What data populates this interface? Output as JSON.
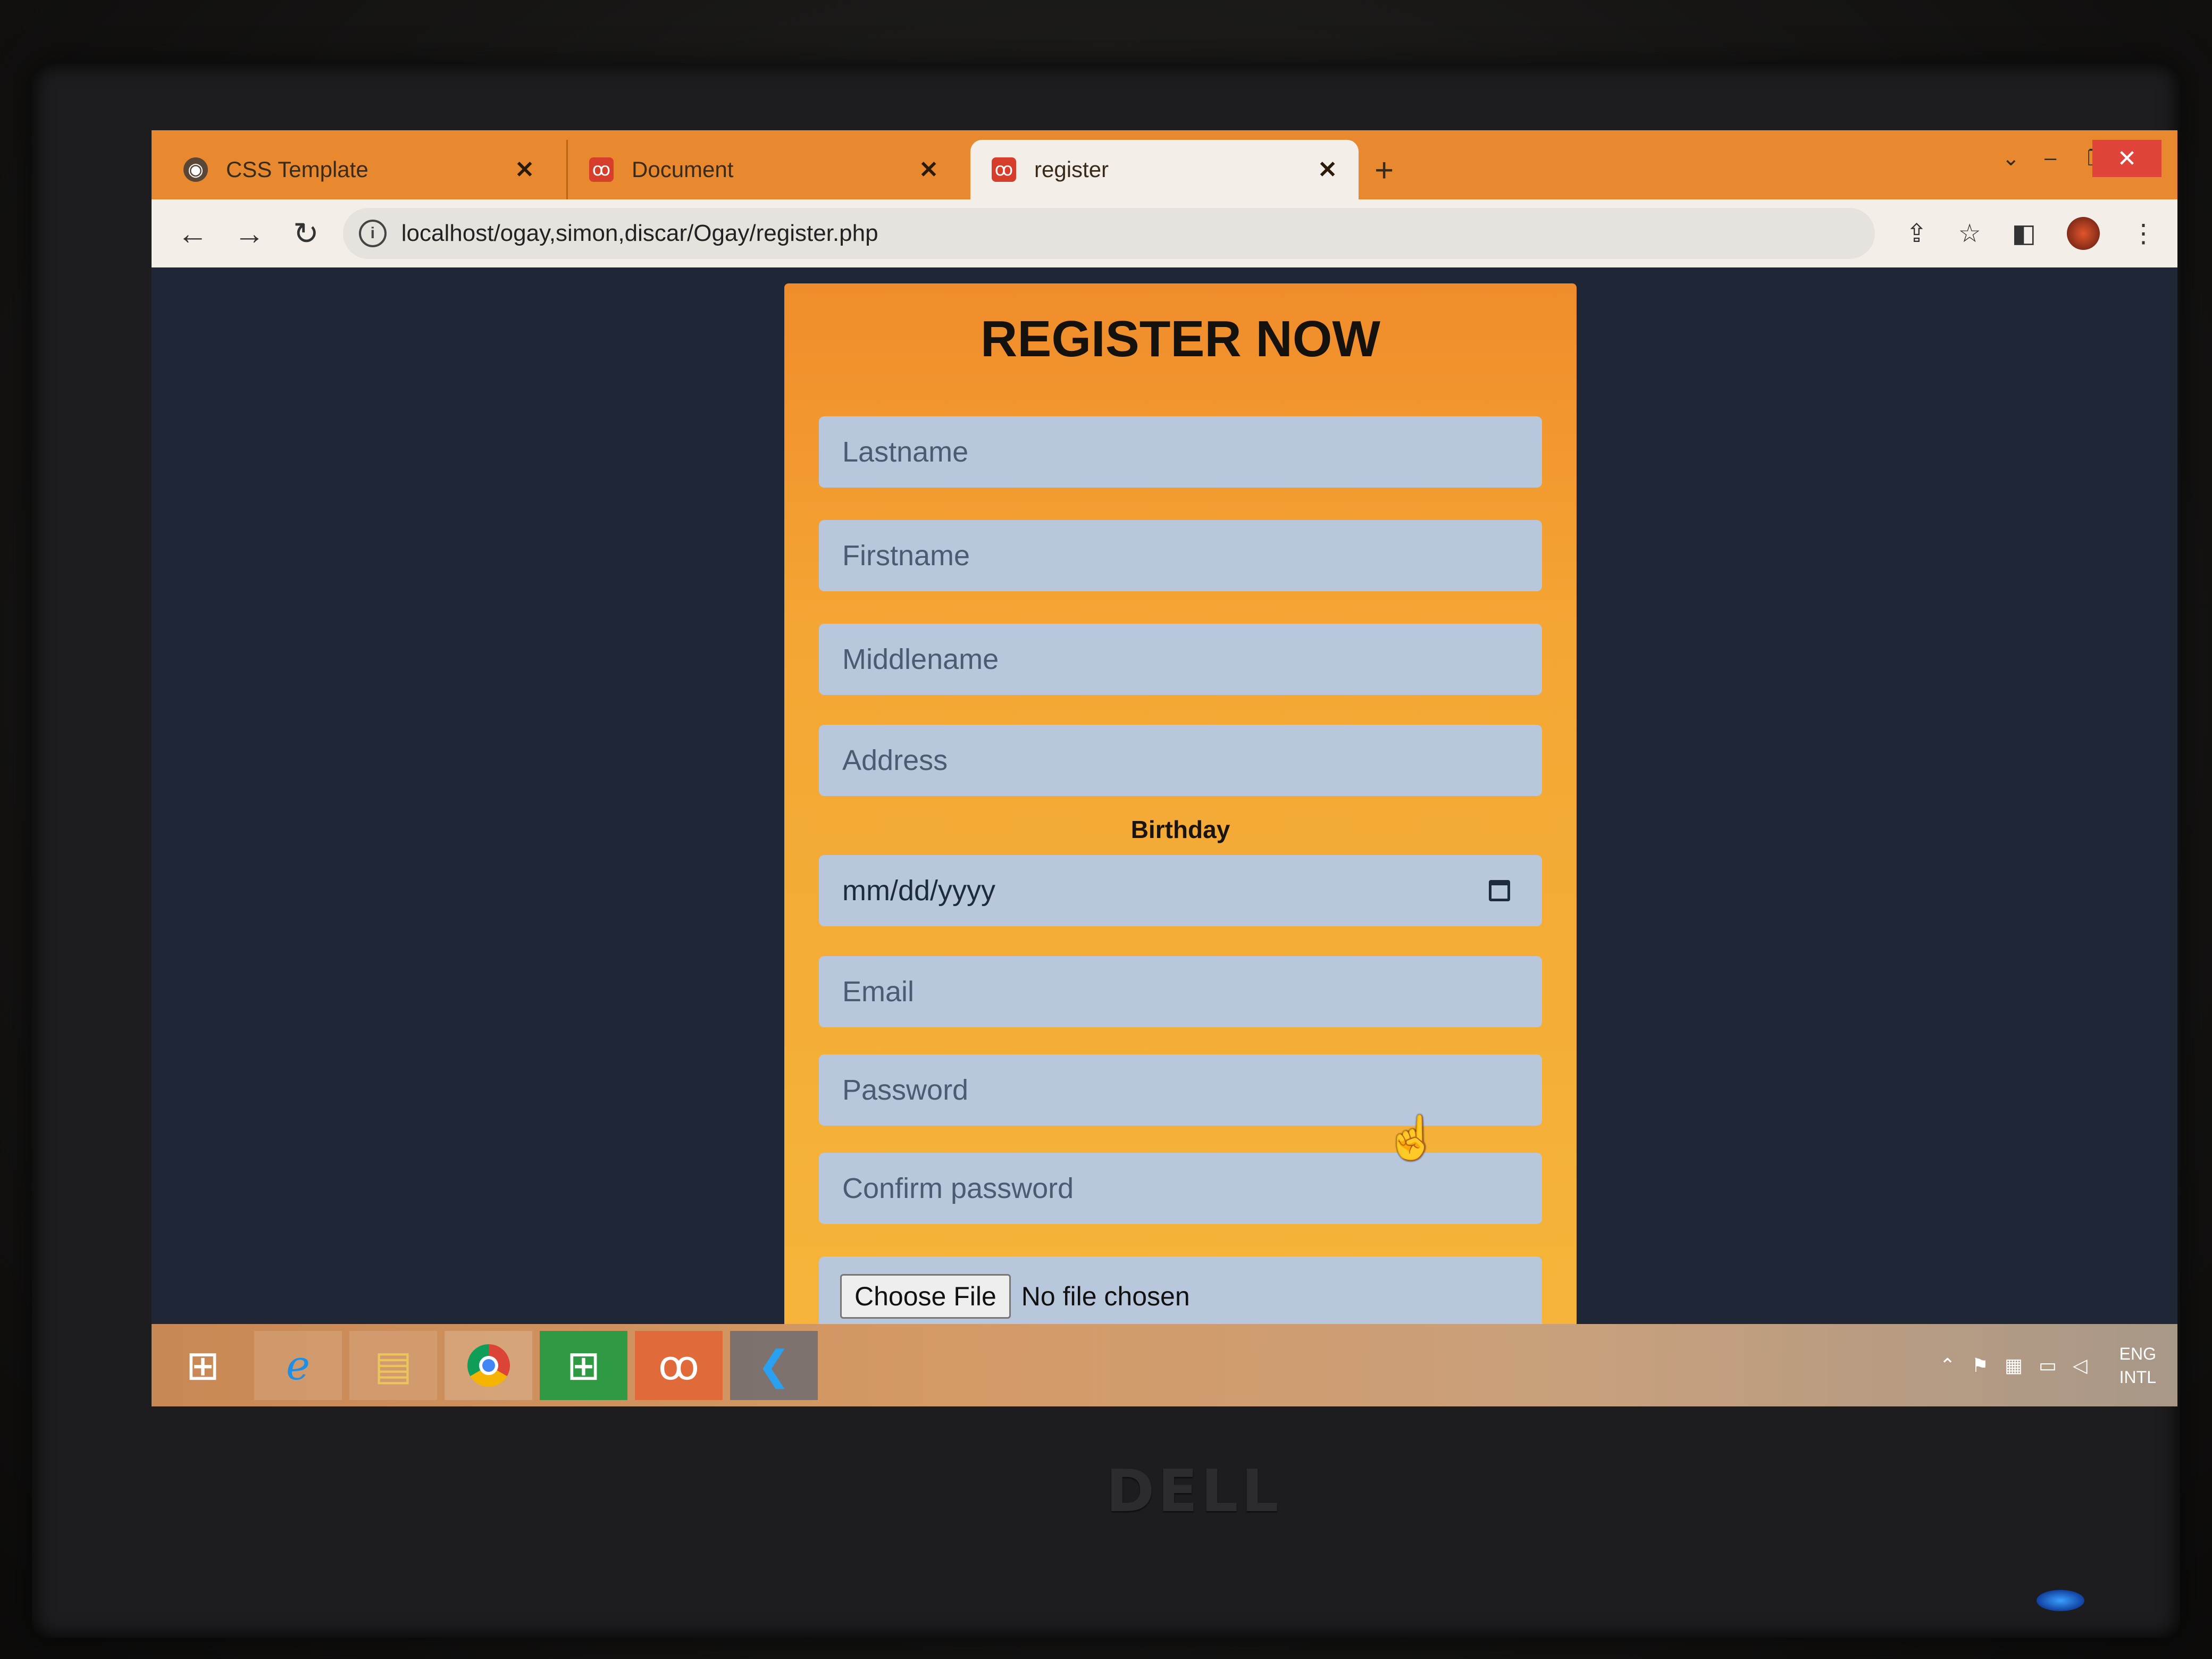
{
  "browser": {
    "tabs": [
      {
        "title": "CSS Template",
        "icon": "globe-icon"
      },
      {
        "title": "Document",
        "icon": "xampp-icon"
      },
      {
        "title": "register",
        "icon": "xampp-icon",
        "active": true
      }
    ],
    "new_tab_symbol": "+",
    "address": "localhost/ogay,simon,discar/Ogay/register.php"
  },
  "form": {
    "heading": "REGISTER NOW",
    "lastname_placeholder": "Lastname",
    "firstname_placeholder": "Firstname",
    "middlename_placeholder": "Middlename",
    "address_placeholder": "Address",
    "birthday_label": "Birthday",
    "birthday_value": "mm/dd/yyyy",
    "email_placeholder": "Email",
    "password_placeholder": "Password",
    "confirm_placeholder": "Confirm password",
    "file_button": "Choose File",
    "file_status": "No file chosen"
  },
  "taskbar": {
    "apps": [
      "start-icon",
      "internet-explorer-icon",
      "file-explorer-icon",
      "chrome-icon",
      "store-icon",
      "xampp-icon",
      "vscode-icon"
    ],
    "lang_top": "ENG",
    "lang_bottom": "INTL"
  },
  "colors": {
    "tab_strip": "#e8892f",
    "card_top": "#f08c2b",
    "card_bottom": "#f5b73a",
    "field_bg": "#b8c7dc",
    "page_bg": "#1f2736"
  },
  "device": {
    "brand": "DELL"
  }
}
